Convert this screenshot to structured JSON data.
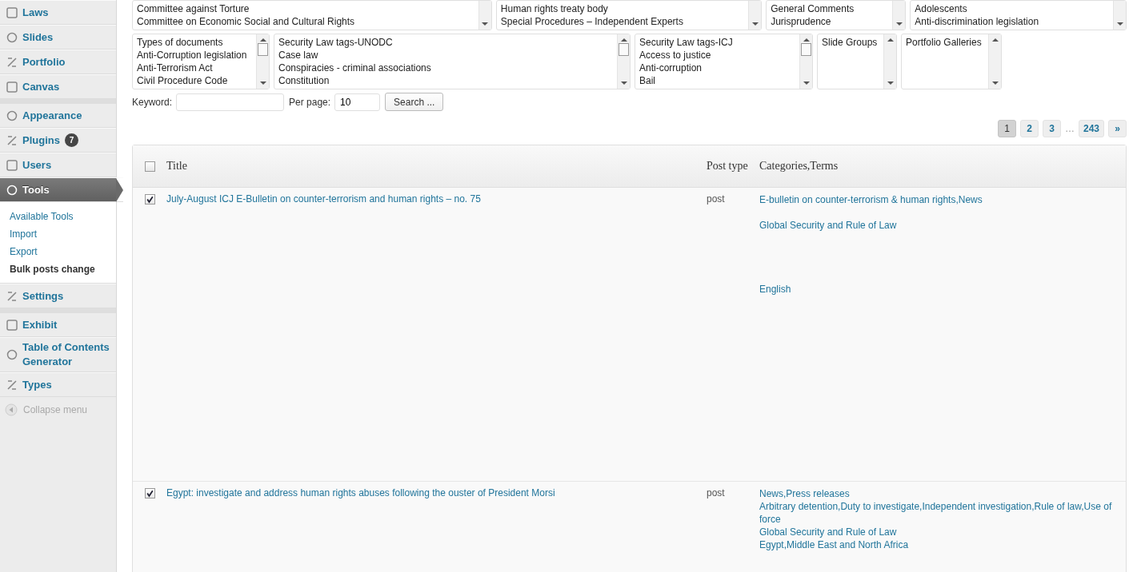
{
  "sidebar": {
    "items": [
      {
        "label": "Laws",
        "selected": false,
        "sep_before": false
      },
      {
        "label": "Slides",
        "selected": false,
        "sep_before": false
      },
      {
        "label": "Portfolio",
        "selected": false,
        "sep_before": false
      },
      {
        "label": "Canvas",
        "selected": false,
        "sep_before": false
      },
      {
        "label": "Appearance",
        "selected": false,
        "sep_before": true
      },
      {
        "label": "Plugins",
        "selected": false,
        "sep_before": false,
        "badge": "7"
      },
      {
        "label": "Users",
        "selected": false,
        "sep_before": false
      },
      {
        "label": "Tools",
        "selected": true,
        "sep_before": false,
        "submenu": [
          {
            "label": "Available Tools",
            "selected": false
          },
          {
            "label": "Import",
            "selected": false
          },
          {
            "label": "Export",
            "selected": false
          },
          {
            "label": "Bulk posts change",
            "selected": true
          }
        ]
      },
      {
        "label": "Settings",
        "selected": false,
        "sep_before": false
      },
      {
        "label": "Exhibit",
        "selected": false,
        "sep_before": true
      },
      {
        "label": "Table of Contents Generator",
        "selected": false,
        "sep_before": false
      },
      {
        "label": "Types",
        "selected": false,
        "sep_before": false
      }
    ],
    "collapse": "Collapse menu"
  },
  "filter_rows": [
    {
      "boxes": [
        {
          "options": [
            "Committee against Torture",
            "Committee on Economic Social and Cultural Rights"
          ]
        },
        {
          "options": [
            "Human rights treaty body",
            "Special Procedures – Independent Experts"
          ]
        },
        {
          "options": [
            "General Comments",
            "Jurisprudence"
          ]
        },
        {
          "options": [
            "Adolescents",
            "Anti-discrimination legislation"
          ]
        }
      ]
    },
    {
      "boxes": [
        {
          "options": [
            "Types of documents",
            "Anti-Corruption legislation",
            "Anti-Terrorism Act",
            "Civil Procedure Code"
          ]
        },
        {
          "options": [
            "Security Law tags-UNODC",
            "Case law",
            "Conspiracies - criminal associations",
            "Constitution"
          ]
        },
        {
          "options": [
            "Security Law tags-ICJ",
            "Access to justice",
            "Anti-corruption",
            "Bail"
          ]
        },
        {
          "options": [
            "Slide Groups"
          ]
        },
        {
          "options": [
            "Portfolio Galleries"
          ]
        }
      ]
    }
  ],
  "search": {
    "keyword_label": "Keyword:",
    "per_page_label": "Per page:",
    "per_page": "10",
    "button": "Search ..."
  },
  "pagination": [
    {
      "kind": "page",
      "label": "1",
      "selected": true
    },
    {
      "kind": "page",
      "label": "2",
      "selected": false
    },
    {
      "kind": "page",
      "label": "3",
      "selected": false
    },
    {
      "kind": "ellipsis",
      "label": "…"
    },
    {
      "kind": "page",
      "label": "243",
      "selected": false
    },
    {
      "kind": "page",
      "label": "»",
      "selected": false
    }
  ],
  "table": {
    "select_all": false,
    "columns": [
      "Title",
      "Post type",
      "Categories,Terms"
    ],
    "rows": [
      {
        "checked": true,
        "title": "July-August ICJ E-Bulletin on counter-terrorism and human rights – no. 75",
        "post_type": "post",
        "terms": [
          "E-bulletin on counter-terrorism & human rights,News",
          "Global Security and Rule of Law",
          "English"
        ]
      },
      {
        "checked": true,
        "title": "Egypt: investigate and address human rights abuses following the ouster of President Morsi",
        "post_type": "post",
        "terms": [
          "News,Press releases",
          "Arbitrary detention,Duty to investigate,Independent investigation,Rule of law,Use of force",
          "Global Security and Rule of Law",
          "Egypt,Middle East and North Africa"
        ]
      }
    ]
  }
}
